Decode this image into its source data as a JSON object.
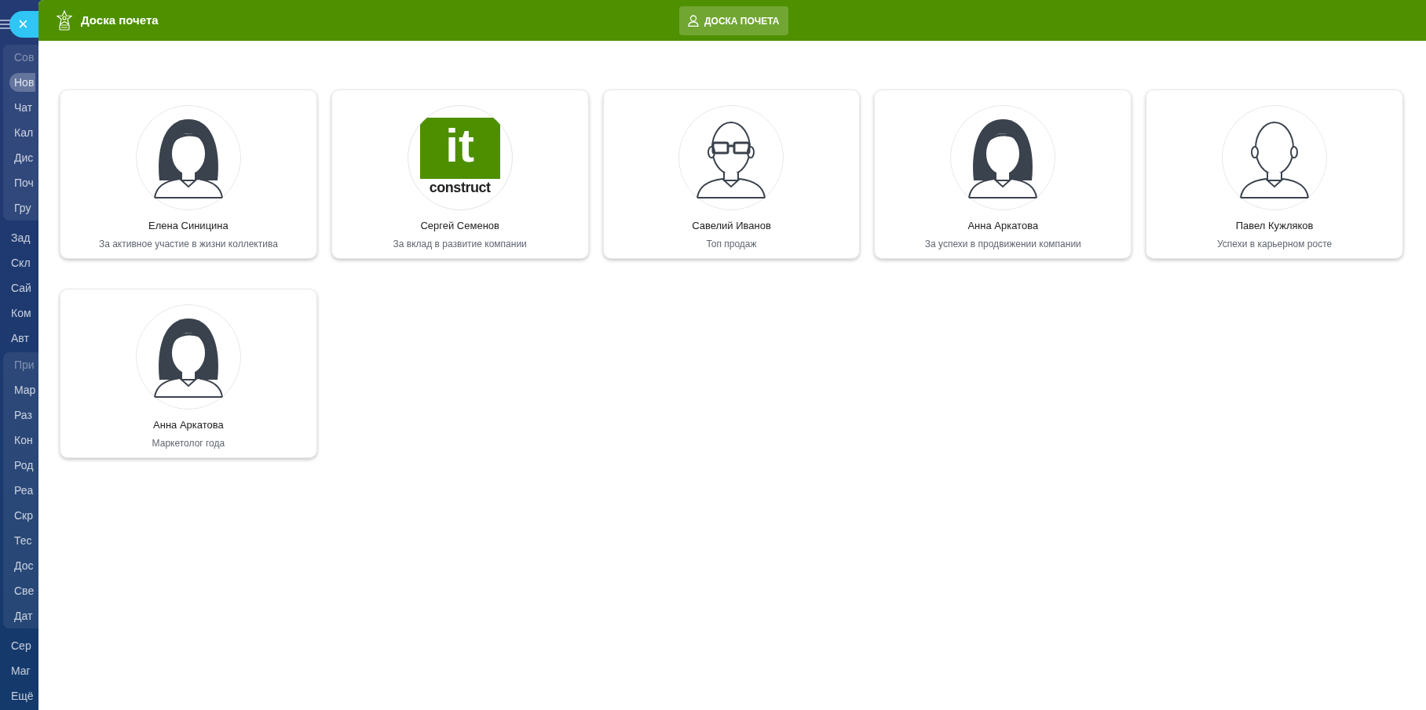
{
  "sidebar": {
    "close_button": "×",
    "sections": [
      {
        "kind": "panel",
        "heading": "Сов",
        "items": [
          {
            "label": "Нов",
            "selected": true
          },
          {
            "label": "Чат",
            "selected": false
          },
          {
            "label": "Кал",
            "selected": false
          },
          {
            "label": "Дис",
            "selected": false
          },
          {
            "label": "Поч",
            "selected": false
          },
          {
            "label": "Гру",
            "selected": false
          }
        ]
      },
      {
        "kind": "plain",
        "items": [
          {
            "label": "Зад",
            "selected": false
          },
          {
            "label": "Скл",
            "selected": false
          },
          {
            "label": "Сай",
            "selected": false
          },
          {
            "label": "Ком",
            "selected": false
          },
          {
            "label": "Авт",
            "selected": false
          }
        ]
      },
      {
        "kind": "panel",
        "heading": "При",
        "items": [
          {
            "label": "Мар",
            "selected": false
          },
          {
            "label": "Раз",
            "selected": false
          },
          {
            "label": "Кон",
            "selected": false
          },
          {
            "label": "Род",
            "selected": false
          },
          {
            "label": "Реа",
            "selected": false
          },
          {
            "label": "Скр",
            "selected": false
          },
          {
            "label": "Тес",
            "selected": false
          },
          {
            "label": "Дос",
            "selected": false
          },
          {
            "label": "Све",
            "selected": false
          },
          {
            "label": "Дат",
            "selected": false
          }
        ]
      },
      {
        "kind": "plain",
        "items": [
          {
            "label": "Сер",
            "selected": false
          },
          {
            "label": "Маг",
            "selected": false
          },
          {
            "label": "Ещё",
            "selected": false
          }
        ]
      }
    ]
  },
  "header": {
    "title": "Доска почета",
    "button": "ДОСКА ПОЧЕТА"
  },
  "cards": [
    {
      "avatar": {
        "kind": "female"
      },
      "name": "Елена Синицина",
      "award": "За активное участие в жизни коллектива"
    },
    {
      "avatar": {
        "kind": "logo",
        "top": "it",
        "bottom": "construct"
      },
      "name": "Сергей Семенов",
      "award": "За вклад в развитие компании"
    },
    {
      "avatar": {
        "kind": "male_glasses"
      },
      "name": "Савелий Иванов",
      "award": "Топ продаж"
    },
    {
      "avatar": {
        "kind": "female"
      },
      "name": "Анна Аркатова",
      "award": "За успехи в продвижении компании"
    },
    {
      "avatar": {
        "kind": "male"
      },
      "name": "Павел Кужляков",
      "award": "Успехи в карьерном росте"
    },
    {
      "avatar": {
        "kind": "female"
      },
      "name": "Анна Аркатова",
      "award": "Маркетолог года"
    }
  ]
}
